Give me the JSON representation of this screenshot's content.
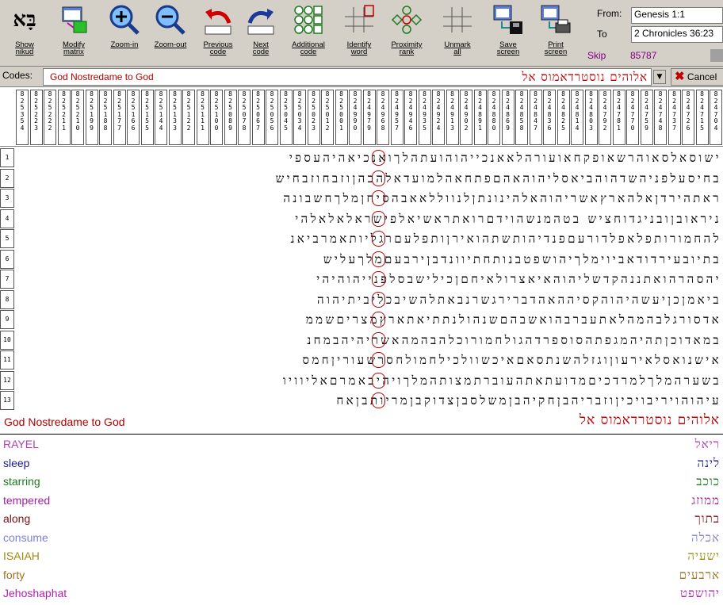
{
  "toolbar": {
    "buttons": [
      {
        "id": "show-nikud",
        "label": "Show\nnikud",
        "glyph": "בָּא"
      },
      {
        "id": "modify-matrix",
        "label": "Modify\nmatrix"
      },
      {
        "id": "zoom-in",
        "label": "Zoom-in"
      },
      {
        "id": "zoom-out",
        "label": "Zoom-out"
      },
      {
        "id": "previous-code",
        "label": "Previous\ncode"
      },
      {
        "id": "next-code",
        "label": "Next\ncode"
      },
      {
        "id": "additional-code",
        "label": "Additional\ncode"
      },
      {
        "id": "identify-word",
        "label": "Identify\nword"
      },
      {
        "id": "proximity-rank",
        "label": "Proximity\nrank"
      },
      {
        "id": "unmark-all",
        "label": "Unmark\nall"
      },
      {
        "id": "save-screen",
        "label": "Save\nscreen"
      },
      {
        "id": "print-screen",
        "label": "Print\nscreen"
      }
    ],
    "from_label": "From:",
    "to_label": "To",
    "from_value": "Genesis 1:1",
    "to_value": "2 Chronicles 36:23",
    "skip_label": "Skip",
    "skip_value": "85787"
  },
  "codes": {
    "label": "Codes:",
    "value": "God Nostredame to God",
    "hebrew": "אלוהים נוסטרדאמוס אל",
    "cancel_label": "Cancel"
  },
  "skip_columns": [
    "8 2 5 3 5 4",
    "8 2 5 2 2 3",
    "8 2 5 2 2 2",
    "8 2 5 2 1 1",
    "8 2 5 2 1 0",
    "8 2 5 1 9 9",
    "8 2 5 1 8 8",
    "8 2 5 1 7 7",
    "8 2 5 1 6 6",
    "8 2 5 1 5 5",
    "8 2 5 1 4 4",
    "8 2 5 1 3 3",
    "8 2 5 1 2 2",
    "8 2 5 1 1 1",
    "8 2 5 1 0 0",
    "8 2 5 0 8 9",
    "8 2 5 0 7 8",
    "8 2 5 0 6 7",
    "8 2 5 0 5 6",
    "8 2 5 0 4 5",
    "8 2 5 0 3 4",
    "8 2 5 0 2 3",
    "8 2 5 0 1 2",
    "8 2 5 0 0 1",
    "8 2 4 9 9 0",
    "8 2 4 9 7 9",
    "8 2 4 9 6 8",
    "8 2 4 9 5 7",
    "8 2 4 9 4 6",
    "8 2 4 9 3 5",
    "8 2 4 9 2 4",
    "8 2 4 9 1 3",
    "8 2 4 9 0 2",
    "8 2 4 8 9 1",
    "8 2 4 8 8 0",
    "8 2 4 8 6 9",
    "8 2 4 8 5 8",
    "8 2 4 8 4 7",
    "8 2 4 8 3 6",
    "8 2 4 8 2 5",
    "8 2 4 8 1 4",
    "8 2 4 8 0 3",
    "8 2 4 7 9 2",
    "8 2 4 7 8 1",
    "8 2 4 7 7 0",
    "8 2 4 7 5 9",
    "8 2 4 7 4 8",
    "8 2 4 7 3 7",
    "8 2 4 7 2 6",
    "8 2 4 7 1 5",
    "8 2 4 7 0 4"
  ],
  "matrix_rows": [
    {
      "n": "1",
      "text": "ישוסאלסאוהרשאופקחאועורהלאאנכייהוהועתהלךואנכיאהיהעספי"
    },
    {
      "n": "2",
      "text": "בחיסעלפניהשדהוהביאסליהוהאהםפתחאהלמועדאלהכהןוזבחוזבחיש"
    },
    {
      "n": "3",
      "text": "ראתהירדןאלהארץאשריהוהאלהינונתןלנווללאאבהסיחןמלךחשבונה"
    },
    {
      "n": "4",
      "text": "ניראובןובניגדוחציש בטהמנשהוידםרואתראשיאלפישראלאלאלהי"
    },
    {
      "n": "5",
      "text": "להחמורותפלאפלדורעםפנדיהותשתהואירןותפלעםרגליותאמרביאנ"
    },
    {
      "n": "6",
      "text": "בתיובעירדודאביוימלךיהושפטבנותחתיוונדבןירבעםמלךעליש"
    },
    {
      "n": "7",
      "text": "יהסהרהואתננהקדשליהוהאיאצרולאיחםןכילישבסלפנייהוהיהי"
    },
    {
      "n": "8",
      "text": "ביאמןכןיעשהיהוהקסיההאהדברירגשרנבאתלהשיבכליביתיהוה"
    },
    {
      "n": "9",
      "text": "אדסורגלבהמהלאתעברבהואשבהםשנהולנתתיאתארץמצריםשממ"
    },
    {
      "n": "10",
      "text": "במאדוכןתהיהמגפתהסוספרדהגולחמורוכלהבהמהאשריהיהבמחנ"
    },
    {
      "n": "11",
      "text": "אישנואסלאירעוןוגזלהשנתסאםאיכשוולכילחמולחסרשעוריןחמס"
    },
    {
      "n": "12",
      "text": "בשערהמלךלמרדכיםמדועתאתהעוברתמצותהמלךויהיבאמרםאליוויו"
    },
    {
      "n": "13",
      "text": "עיהוהויריבויכיןוזבריהבןחקיהבןמשלסבןצדוקבןמריותבןאח"
    }
  ],
  "status": {
    "text": "God Nostredame to God",
    "hebrew": "אלוהים נוסטרדאמוס אל"
  },
  "legend": [
    {
      "word": "RAYEL",
      "color": "#b040b0",
      "hebrew": "ריאל"
    },
    {
      "word": "sleep",
      "color": "#1a1a8a",
      "hebrew": "לינה"
    },
    {
      "word": "starring",
      "color": "#1e7a1e",
      "hebrew": "כוכב"
    },
    {
      "word": "tempered",
      "color": "#a020a0",
      "hebrew": "ממוזג"
    },
    {
      "word": "along",
      "color": "#7a1010",
      "hebrew": "בתוך"
    },
    {
      "word": "consume",
      "color": "#8080d0",
      "hebrew": "אכלה"
    },
    {
      "word": "ISAIAH",
      "color": "#a08a10",
      "hebrew": "ישעיה"
    },
    {
      "word": "forty",
      "color": "#a07020",
      "hebrew": "ארבעים"
    },
    {
      "word": "Jehoshaphat",
      "color": "#b020b0",
      "hebrew": "יהושפט"
    }
  ],
  "colors": {
    "toolbar_bg": "#d4d0c8",
    "code_red": "#c00000"
  }
}
